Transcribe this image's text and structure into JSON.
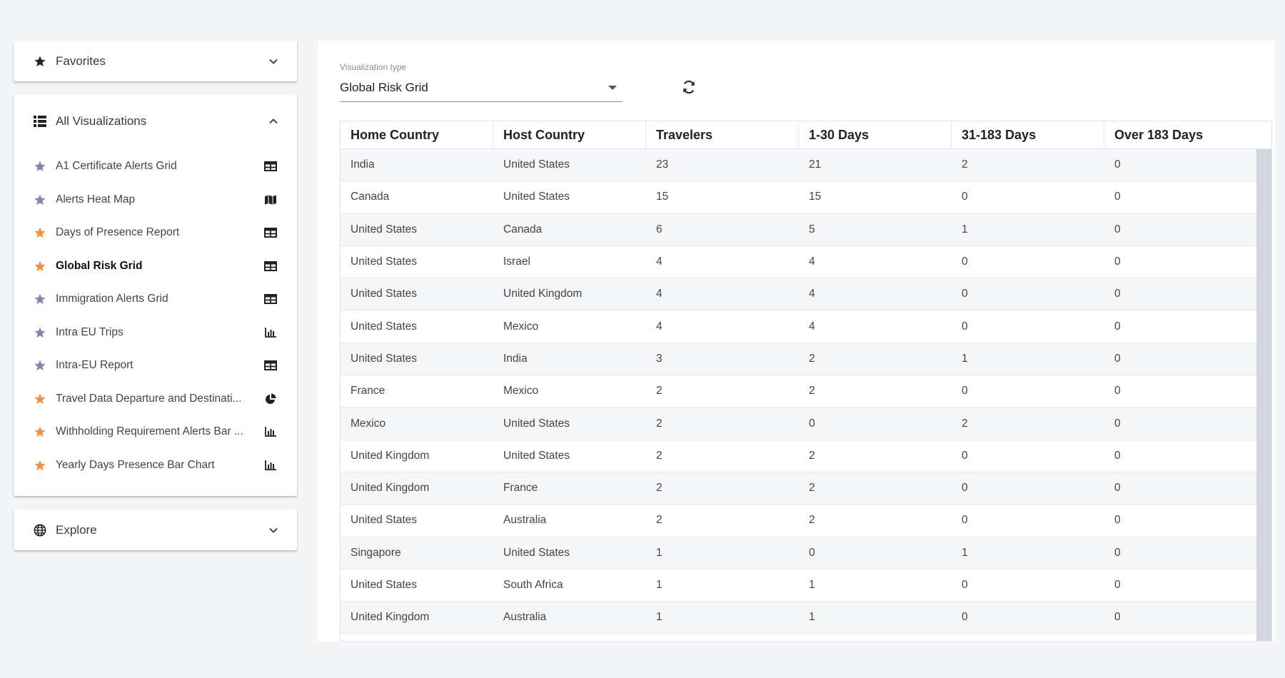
{
  "sidebar": {
    "favorites": {
      "title": "Favorites",
      "icon": "star-icon",
      "expanded": false
    },
    "all_visualizations": {
      "title": "All Visualizations",
      "icon": "list-icon",
      "expanded": true,
      "items": [
        {
          "label": "A1 Certificate Alerts Grid",
          "favorite": false,
          "type_icon": "table-icon",
          "active": false
        },
        {
          "label": "Alerts Heat Map",
          "favorite": false,
          "type_icon": "map-icon",
          "active": false
        },
        {
          "label": "Days of Presence Report",
          "favorite": true,
          "type_icon": "table-icon",
          "active": false
        },
        {
          "label": "Global Risk Grid",
          "favorite": true,
          "type_icon": "table-icon",
          "active": true
        },
        {
          "label": "Immigration Alerts Grid",
          "favorite": false,
          "type_icon": "table-icon",
          "active": false
        },
        {
          "label": "Intra EU Trips",
          "favorite": false,
          "type_icon": "bar-chart-icon",
          "active": false
        },
        {
          "label": "Intra-EU Report",
          "favorite": false,
          "type_icon": "table-icon",
          "active": false
        },
        {
          "label": "Travel Data Departure and Destinati...",
          "favorite": true,
          "type_icon": "pie-chart-icon",
          "active": false
        },
        {
          "label": "Withholding Requirement Alerts Bar ...",
          "favorite": true,
          "type_icon": "bar-chart-icon",
          "active": false
        },
        {
          "label": "Yearly Days Presence Bar Chart",
          "favorite": true,
          "type_icon": "bar-chart-icon",
          "active": false
        }
      ]
    },
    "explore": {
      "title": "Explore",
      "icon": "globe-icon",
      "expanded": false
    }
  },
  "main": {
    "visualization_type": {
      "label": "Visualization type",
      "value": "Global Risk Grid"
    },
    "grid": {
      "columns": [
        "Home Country",
        "Host Country",
        "Travelers",
        "1-30 Days",
        "31-183 Days",
        "Over 183 Days"
      ],
      "rows": [
        [
          "India",
          "United States",
          "23",
          "21",
          "2",
          "0"
        ],
        [
          "Canada",
          "United States",
          "15",
          "15",
          "0",
          "0"
        ],
        [
          "United States",
          "Canada",
          "6",
          "5",
          "1",
          "0"
        ],
        [
          "United States",
          "Israel",
          "4",
          "4",
          "0",
          "0"
        ],
        [
          "United States",
          "United Kingdom",
          "4",
          "4",
          "0",
          "0"
        ],
        [
          "United States",
          "Mexico",
          "4",
          "4",
          "0",
          "0"
        ],
        [
          "United States",
          "India",
          "3",
          "2",
          "1",
          "0"
        ],
        [
          "France",
          "Mexico",
          "2",
          "2",
          "0",
          "0"
        ],
        [
          "Mexico",
          "United States",
          "2",
          "0",
          "2",
          "0"
        ],
        [
          "United Kingdom",
          "United States",
          "2",
          "2",
          "0",
          "0"
        ],
        [
          "United Kingdom",
          "France",
          "2",
          "2",
          "0",
          "0"
        ],
        [
          "United States",
          "Australia",
          "2",
          "2",
          "0",
          "0"
        ],
        [
          "Singapore",
          "United States",
          "1",
          "0",
          "1",
          "0"
        ],
        [
          "United States",
          "South Africa",
          "1",
          "1",
          "0",
          "0"
        ],
        [
          "United Kingdom",
          "Australia",
          "1",
          "1",
          "0",
          "0"
        ]
      ]
    }
  },
  "colors": {
    "star_favorite": "#f5923e",
    "star_default": "#7f8aa8",
    "background": "#f4f5f7",
    "row_alt": "#f5f6f8",
    "scrollbar_thumb": "#d3d6de"
  }
}
